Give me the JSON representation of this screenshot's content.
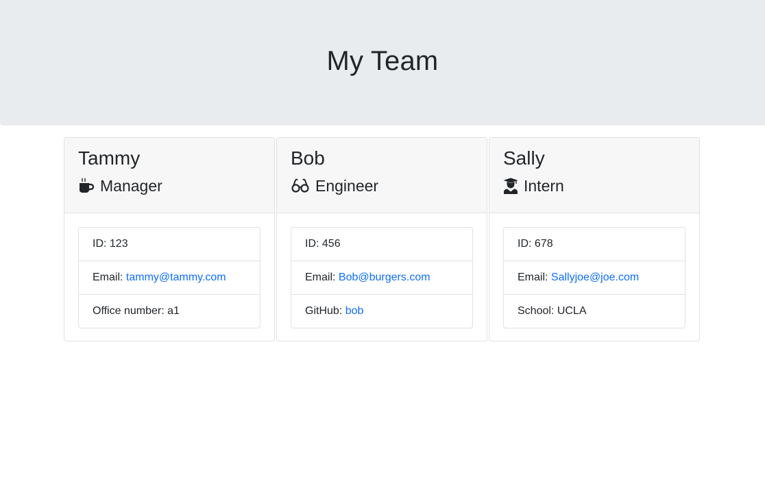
{
  "header": {
    "title": "My Team"
  },
  "colors": {
    "jumbotron_bg": "#e9ecef",
    "card_header_bg": "#f7f7f7",
    "link": "#0d6efd",
    "text": "#212529"
  },
  "cards": [
    {
      "name": "Tammy",
      "role": "Manager",
      "icon": "mug-hot-icon",
      "id_label": "ID: ",
      "id": "123",
      "email_label": "Email: ",
      "email": "tammy@tammy.com",
      "extra_label": "Office number: ",
      "extra_value": "a1"
    },
    {
      "name": "Bob",
      "role": "Engineer",
      "icon": "glasses-icon",
      "id_label": "ID: ",
      "id": "456",
      "email_label": "Email: ",
      "email": "Bob@burgers.com",
      "extra_label": "GitHub: ",
      "extra_value": "bob"
    },
    {
      "name": "Sally",
      "role": "Intern",
      "icon": "graduate-icon",
      "id_label": "ID: ",
      "id": "678",
      "email_label": "Email: ",
      "email": "Sallyjoe@joe.com",
      "extra_label": "School: ",
      "extra_value": "UCLA"
    }
  ]
}
